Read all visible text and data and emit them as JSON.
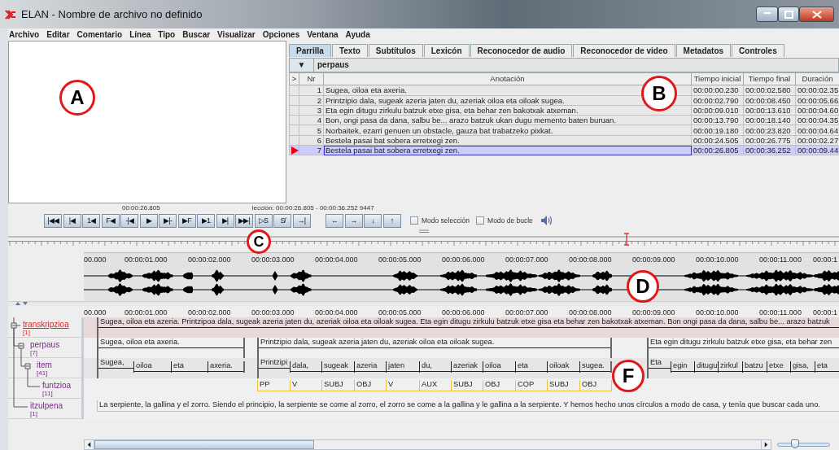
{
  "window": {
    "title": "ELAN - Nombre de archivo no definido"
  },
  "menu": [
    "Archivo",
    "Editar",
    "Comentario",
    "Línea",
    "Tipo",
    "Buscar",
    "Visualizar",
    "Opciones",
    "Ventana",
    "Ayuda"
  ],
  "tabs": [
    {
      "label": "Parrilla",
      "selected": true
    },
    {
      "label": "Texto",
      "selected": false
    },
    {
      "label": "Subtítulos",
      "selected": false
    },
    {
      "label": "Lexicón",
      "selected": false
    },
    {
      "label": "Reconocedor de audio",
      "selected": false
    },
    {
      "label": "Reconocedor de video",
      "selected": false
    },
    {
      "label": "Metadatos",
      "selected": false
    },
    {
      "label": "Controles",
      "selected": false
    }
  ],
  "tier_selector": {
    "arrow": "▼",
    "value": "perpaus"
  },
  "table": {
    "columns": [
      ">",
      "Nr",
      "Anotación",
      "Tiempo inicial",
      "Tiempo final",
      "Duración"
    ],
    "rows": [
      {
        "nr": "1",
        "annotation": "Sugea, oiloa eta axeria.",
        "start": "00:00:00.230",
        "end": "00:00:02.580",
        "duration": "00:00:02.35",
        "selected": false
      },
      {
        "nr": "2",
        "annotation": "Printzipio dala, sugeak azeria jaten du, azeriak oiloa eta oiloak sugea.",
        "start": "00:00:02.790",
        "end": "00:00:08.450",
        "duration": "00:00:05.66",
        "selected": false
      },
      {
        "nr": "3",
        "annotation": "Eta  egin ditugu zirkulu batzuk etxe gisa, eta behar zen bakotxak atxeman.",
        "start": "00:00:09.010",
        "end": "00:00:13.610",
        "duration": "00:00:04.60",
        "selected": false
      },
      {
        "nr": "4",
        "annotation": "Bon, ongi pasa da dana, salbu be... arazo batzuk ukan dugu memento baten buruan.",
        "start": "00:00:13.790",
        "end": "00:00:18.140",
        "duration": "00:00:04.35",
        "selected": false
      },
      {
        "nr": "5",
        "annotation": "Norbaitek, ezarri genuen un obstacle, gauza bat trabatzeko pixkat.",
        "start": "00:00:19.180",
        "end": "00:00:23.820",
        "duration": "00:00:04.64",
        "selected": false
      },
      {
        "nr": "6",
        "annotation": "Bestela pasai bat sobera erretxegi zen.",
        "start": "00:00:24.505",
        "end": "00:00:26.775",
        "duration": "00:00:02.27",
        "selected": false
      },
      {
        "nr": "7",
        "annotation": "Bestela pasai bat sobera erretxegi zen.",
        "start": "00:00:26.805",
        "end": "00:00:36.252",
        "duration": "00:00:09.44",
        "selected": true
      }
    ]
  },
  "media_time": "00:00:26.805",
  "selection_info": "lección: 00:00:26.805 - 00:00:36.252  9447",
  "media_buttons": [
    "|◀◀",
    "|◀",
    "1◀",
    "F◀",
    "-|◀",
    "▶",
    "▶|-",
    "▶F",
    "▶1",
    "▶|",
    "▶▶|",
    "▷S",
    "S̸",
    "→|"
  ],
  "arrow_buttons": [
    "←",
    "→",
    "↓",
    "↑"
  ],
  "checkboxes": [
    {
      "label": "Modo selección",
      "checked": false
    },
    {
      "label": "Modo de bucle",
      "checked": false
    }
  ],
  "waveform": {
    "ticks": [
      "00.000",
      "00:00:01.000",
      "00:00:02.000",
      "00:00:03.000",
      "00:00:04.000",
      "00:00:05.000",
      "00:00:06.000",
      "00:00:07.000",
      "00:00:08.000",
      "00:00:09.000",
      "00:00:10.000",
      "00:00:11.000",
      "00:00:1"
    ]
  },
  "annotation_timeline": {
    "ticks": [
      "00.000",
      "00:00:01.000",
      "00:00:02.000",
      "00:00:03.000",
      "00:00:04.000",
      "00:00:05.000",
      "00:00:06.000",
      "00:00:07.000",
      "00:00:08.000",
      "00:00:09.000",
      "00:00:10.000",
      "00:00:11.000",
      "00:00:1"
    ]
  },
  "tiers": [
    {
      "name": "transkripzioa",
      "count": "[1]",
      "selected": true,
      "kind": "aligned",
      "annotations": [
        "Sugea, oiloa eta azeria. Printzipoa dala, sugeak azeria jaten du, azeriak oiloa eta oiloak sugea. Eta egin ditugu zirkulu batzuk etxe gisa eta behar zen bakotxak atxeman. Bon ongi pasa da dana, salbu be... arazo batzuk"
      ],
      "children": [
        {
          "name": "perpaus",
          "count": "[7]",
          "selected": false,
          "kind": "aligned",
          "annotations": [
            "Sugea, oiloa eta axeria.",
            "Printzipio dala, sugeak azeria jaten du, azeriak oiloa eta oiloak sugea.",
            "Eta  egin ditugu zirkulu batzuk etxe gisa, eta behar zen"
          ],
          "children": [
            {
              "name": "item",
              "count": "[41]",
              "selected": false,
              "kind": "subdivision",
              "annotations": [
                "Sugea,",
                "oiloa",
                "eta",
                "axeria.",
                "Printzipi",
                "dala,",
                "sugeak",
                "azeria",
                "jaten",
                "du,",
                "azeriak",
                "oiloa",
                "eta",
                "oiloak",
                "sugea.",
                "Eta",
                "egin",
                "ditugu",
                "zirkul",
                "batzu",
                "etxe",
                "gisa,",
                "eta"
              ],
              "children": [
                {
                  "name": "funtzioa",
                  "count": "[11]",
                  "selected": false,
                  "kind": "symbolic",
                  "annotations": [
                    "PP",
                    "V",
                    "SUBJ",
                    "OBJ",
                    "V",
                    "AUX",
                    "SUBJ",
                    "OBJ",
                    "COP",
                    "SUBJ",
                    "OBJ"
                  ]
                }
              ]
            }
          ]
        },
        {
          "name": "itzulpena",
          "count": "[1]",
          "selected": false,
          "kind": "symbolic",
          "annotations": [
            "La serpiente, la gallina y el zorro. Siendo el principio, la serpiente se come al zorro, el zorro se come a la gallina y le gallina a la serpiente. Y hemos hecho unos círculos a modo de casa, y tenía que buscar cada uno."
          ]
        }
      ]
    }
  ],
  "zoom_slider": {
    "level": 0.3
  },
  "callouts": [
    {
      "letter": "A"
    },
    {
      "letter": "B"
    },
    {
      "letter": "C"
    },
    {
      "letter": "D"
    },
    {
      "letter": "F"
    }
  ]
}
